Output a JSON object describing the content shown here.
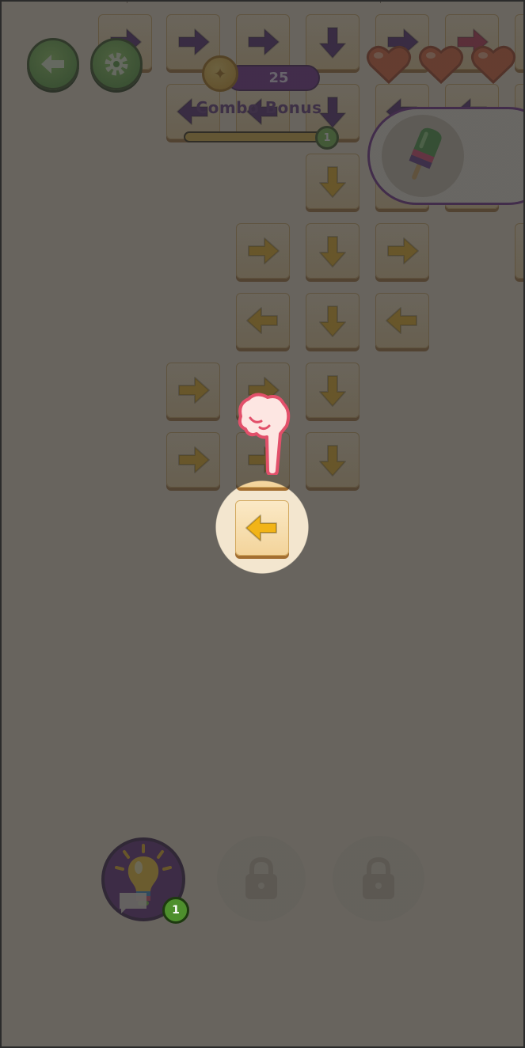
{
  "score": {
    "value": "25",
    "combo_label": "Combo Bonus",
    "combo_level": "1",
    "combo_progress": 0.95
  },
  "lives": {
    "count": 3
  },
  "goal": {
    "item": "popsicle-icon"
  },
  "board": {
    "tiles": [
      {
        "dir": "right",
        "color": "#4b1c6e"
      },
      {
        "dir": "right",
        "color": "#4b1c6e"
      },
      {
        "dir": "right",
        "color": "#4b1c6e"
      },
      {
        "dir": "down",
        "color": "#4b1c6e"
      },
      {
        "dir": "right",
        "color": "#4b1c6e"
      },
      {
        "dir": "right",
        "color": "#c0264b"
      },
      {
        "dir": "left",
        "color": "#4b1c6e"
      },
      {
        "dir": "left",
        "color": "#4b1c6e"
      },
      {
        "dir": "down",
        "color": "#4b1c6e"
      },
      {
        "dir": "left",
        "color": "#4b1c6e"
      },
      {
        "dir": "left",
        "color": "#4b1c6e"
      },
      {
        "dir": "down",
        "color": "#f2b417"
      },
      {
        "dir": "right",
        "color": "#f2b417"
      },
      {
        "dir": "down",
        "color": "#f2b417"
      },
      {
        "dir": "right",
        "color": "#f2b417"
      },
      {
        "dir": "left",
        "color": "#f2b417"
      },
      {
        "dir": "down",
        "color": "#f2b417"
      },
      {
        "dir": "left",
        "color": "#f2b417"
      },
      {
        "dir": "right",
        "color": "#f2b417"
      },
      {
        "dir": "right",
        "color": "#f2b417"
      },
      {
        "dir": "down",
        "color": "#f2b417"
      },
      {
        "dir": "right",
        "color": "#f2b417"
      },
      {
        "dir": "right",
        "color": "#f2b417"
      },
      {
        "dir": "down",
        "color": "#f2b417"
      }
    ],
    "highlighted_tile": {
      "dir": "left",
      "color": "#f2b417"
    }
  },
  "boosters": {
    "hint": {
      "icon": "lightbulb-icon",
      "count": "1"
    },
    "slot2": {
      "icon": "lock-icon",
      "locked": true
    },
    "slot3": {
      "icon": "lock-icon",
      "locked": true
    }
  },
  "tutorial": {
    "pointer": "pointing-hand-icon"
  },
  "colors": {
    "accent": "#6a1f8c",
    "arrow": "#f2b417",
    "button_green": "#4caf35"
  }
}
